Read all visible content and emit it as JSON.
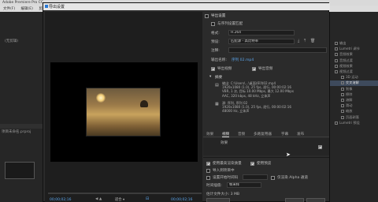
{
  "background": {
    "title": "Adobe Premiere Pro CC",
    "menu": [
      "文件(F)",
      "编辑(E)",
      "剪辑(C)",
      "序"
    ],
    "left_panel_label": "(无剪辑)",
    "bottom_panel_label": "项目未命名.prproj",
    "project_tree": [
      {
        "label": "输出",
        "selected": false
      },
      {
        "label": "Lumetri 调节",
        "selected": false
      },
      {
        "label": "音频效果",
        "selected": false
      },
      {
        "label": "音频过渡",
        "selected": false
      },
      {
        "label": "视频效果",
        "selected": false
      },
      {
        "label": "视频过渡",
        "selected": false
      },
      {
        "label": "3D 运动",
        "selected": false
      },
      {
        "label": "交叉溶解",
        "selected": true
      },
      {
        "label": "划像",
        "selected": false
      },
      {
        "label": "擦除",
        "selected": false
      },
      {
        "label": "溶解",
        "selected": false
      },
      {
        "label": "滑动",
        "selected": false
      },
      {
        "label": "缩放",
        "selected": false
      },
      {
        "label": "页面剥落",
        "selected": false
      },
      {
        "label": "Lumetri 预设",
        "selected": false
      }
    ]
  },
  "dialog": {
    "title": "导出设置",
    "timecode_start": "00;00;02;16",
    "timecode_end": "00;00;02;16",
    "fit_option": "适合",
    "settings": {
      "section_header": "导出设置",
      "match_sequence_label": "与序列设置匹配",
      "format_label": "格式:",
      "format_value": "H.264",
      "preset_label": "预设:",
      "preset_value": "匹配源 - 高比特率",
      "comment_label": "注释:",
      "output_name_label": "输出名称:",
      "output_name_value": "序列 02.mp4",
      "export_video_label": "导出视频",
      "export_audio_label": "导出音频",
      "summary_header": "摘要",
      "summary_output_lines": [
        "输出: C:\\Users\\...\\桌面\\序列02.mp4",
        "1920x1080 (1.0), 25 fps, 逐行, 00:00:02:16",
        "VBR, 1 次, 目标 10.00 Mbps, 最大 12.00 Mbps",
        "AAC, 320 kbps, 48 kHz, 立体声"
      ],
      "summary_source_lines": [
        "源: 序列, 序列 02",
        "1920x1080 (1.0), 25 fps, 逐行, 00:00:02:16",
        "48000 Hz, 立体声"
      ],
      "tabs": [
        "效果",
        "视频",
        "音频",
        "多路复用器",
        "字幕",
        "发布"
      ],
      "tab_content_label": "效果",
      "use_max_render_label": "使用最高渲染质量",
      "use_previews_label": "使用预览",
      "import_into_project_label": "导入到项目中",
      "set_start_timecode_label": "设置开始时间码",
      "render_alpha_label": "仅渲染 Alpha 通道",
      "time_interp_label": "时间插值:",
      "time_interp_value": "帧采样",
      "file_size_label": "估计文件大小: 3 MB"
    }
  }
}
